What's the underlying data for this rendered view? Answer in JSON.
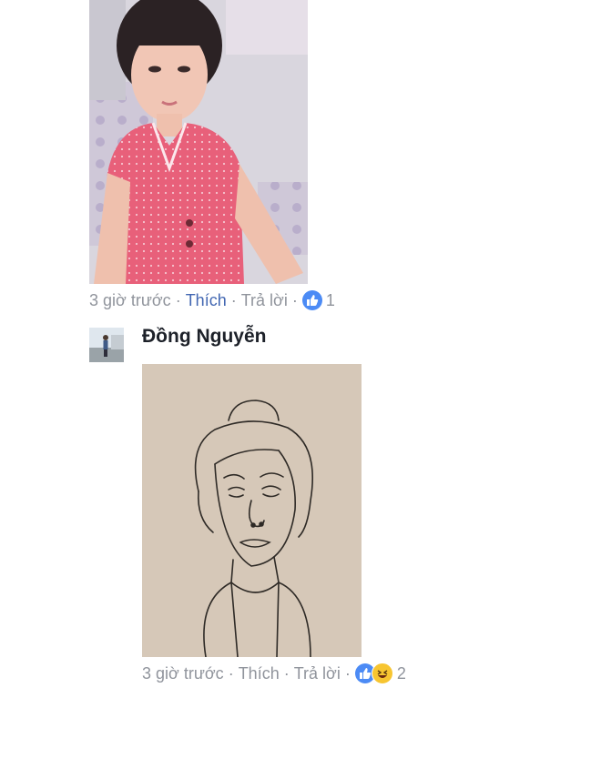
{
  "comment1": {
    "time": "3 giờ trước",
    "like_label": "Thích",
    "reply_label": "Trả lời",
    "reaction_count": "1"
  },
  "comment2": {
    "author": "Đồng Nguyễn",
    "time": "3 giờ trước",
    "like_label": "Thích",
    "reply_label": "Trả lời",
    "reaction_count": "2"
  },
  "icons": [
    "thumbs-up-icon",
    "laughing-emoji-icon"
  ],
  "colors": {
    "link_blue": "#4267b2",
    "meta_gray": "#90949c",
    "like_blue": "#4c8bf5",
    "haha_yellow": "#f7c531"
  }
}
